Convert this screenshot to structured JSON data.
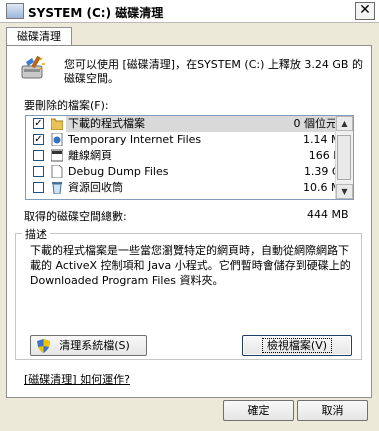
{
  "window": {
    "title": "SYSTEM  (C:) 磁碟清理",
    "close_glyph": "✕"
  },
  "tab": {
    "label": "磁碟清理"
  },
  "header": {
    "text": "您可以使用 [磁碟清理]，在SYSTEM (C:) 上釋放 3.24 GB 的磁碟空間。"
  },
  "list": {
    "label": "要刪除的檔案(F):",
    "items": [
      {
        "name": "下載的程式檔案",
        "size": "0 個位元組",
        "checked": true,
        "icon": "folder-icon"
      },
      {
        "name": "Temporary Internet Files",
        "size": "1.14 MB",
        "checked": true,
        "icon": "internet-files-icon"
      },
      {
        "name": "離線網頁",
        "size": "166 KB",
        "checked": false,
        "icon": "offline-pages-icon"
      },
      {
        "name": "Debug Dump Files",
        "size": "1.39 GB",
        "checked": false,
        "icon": "blank-file-icon"
      },
      {
        "name": "資源回收筒",
        "size": "10.6 MB",
        "checked": false,
        "icon": "recycle-bin-icon"
      }
    ],
    "scroll_up": "▲",
    "scroll_down": "▼"
  },
  "total": {
    "label": "取得的磁碟空間總數:",
    "value": "444 MB"
  },
  "description": {
    "legend": "描述",
    "text": "下載的程式檔案是一些當您瀏覽特定的網頁時，自動從網際網路下載的 ActiveX 控制項和 Java 小程式。它們暫時會儲存到硬碟上的 Downloaded Program Files 資料夾。"
  },
  "buttons": {
    "clean_system": "清理系統檔(S)",
    "view_files": "檢視檔案(V)",
    "ok": "確定",
    "cancel": "取消"
  },
  "help_link": "[磁碟清理] 如何運作?",
  "colors": {
    "selection": "#d9d9d9",
    "list_border": "#7f9db9",
    "check_border": "#1c5180"
  }
}
